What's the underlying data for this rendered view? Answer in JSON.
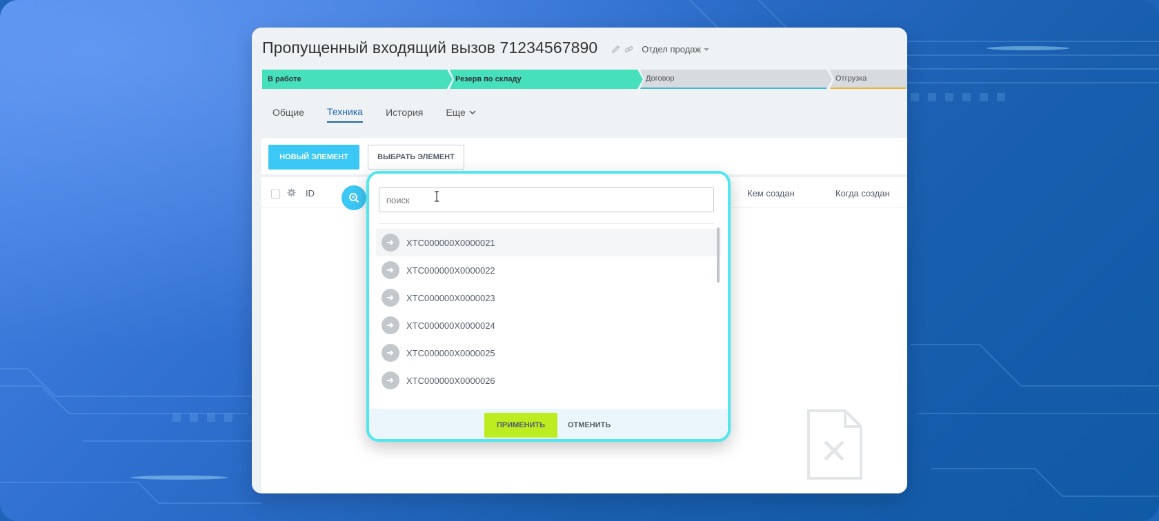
{
  "deal": {
    "title": "Пропущенный входящий вызов 71234567890",
    "department": "Отдел продаж"
  },
  "stages": [
    {
      "label": "В работе"
    },
    {
      "label": "Резерв по складу"
    },
    {
      "label": "Договор"
    },
    {
      "label": "Отгрузка"
    }
  ],
  "tabs": {
    "general": "Общие",
    "technika": "Техника",
    "history": "История",
    "more": "Еще"
  },
  "toolbar": {
    "new_element": "НОВЫЙ ЭЛЕМЕНТ",
    "select_element": "ВЫБРАТЬ ЭЛЕМЕНТ"
  },
  "grid": {
    "columns": {
      "id": "ID",
      "created_by": "Кем создан",
      "created_at": "Когда создан"
    }
  },
  "popup": {
    "search_placeholder": "поиск",
    "items": [
      "XTC000000X0000021",
      "XTC000000X0000022",
      "XTC000000X0000023",
      "XTC000000X0000024",
      "XTC000000X0000025",
      "XTC000000X0000026"
    ],
    "apply": "ПРИМЕНИТЬ",
    "cancel": "ОТМЕНИТЬ"
  },
  "colors": {
    "stage_active": "#47e0bd",
    "primary_button": "#3bc8f5",
    "apply_button": "#bbed21",
    "popup_border": "#52e7ee",
    "tab_active": "#2067b0"
  },
  "icons": [
    "pencil-icon",
    "link-icon",
    "gear-icon",
    "search-icon",
    "arrow-right-icon",
    "chevron-down-icon",
    "empty-file-icon",
    "text-cursor-icon"
  ]
}
